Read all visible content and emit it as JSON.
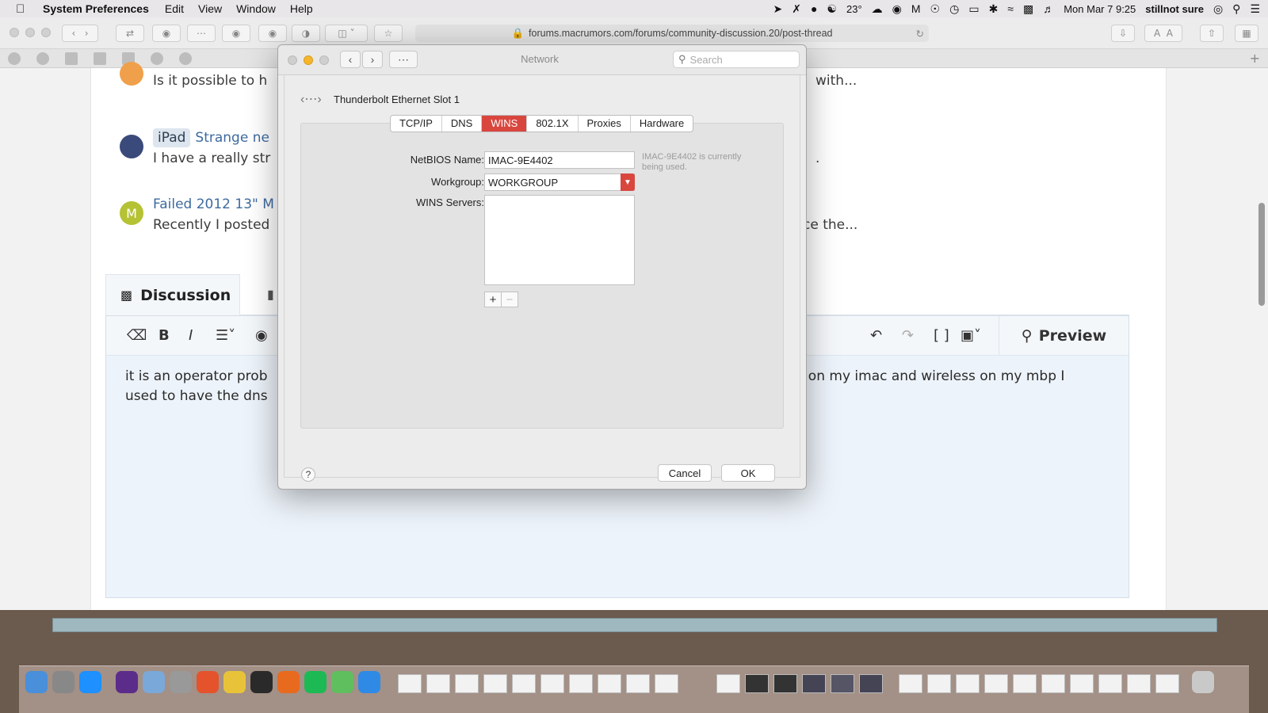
{
  "menubar": {
    "app_name": "System Preferences",
    "items": [
      "Edit",
      "View",
      "Window",
      "Help"
    ],
    "status": {
      "temperature": "23°",
      "datetime": "Mon Mar 7  9:25",
      "user": "stillnot sure"
    }
  },
  "browser": {
    "url": "forums.macrumors.com/forums/community-discussion.20/post-thread"
  },
  "forum": {
    "threads": [
      {
        "avatar_letter": "",
        "tag": "",
        "title": "",
        "snippet": "Is it possible to h",
        "snippet_end": "with..."
      },
      {
        "avatar_letter": "",
        "tag": "iPad",
        "title": "Strange ne",
        "snippet": "I have a really str",
        "snippet_end": "."
      },
      {
        "avatar_letter": "M",
        "tag": "",
        "title": "Failed 2012 13\" M",
        "snippet": "Recently I posted",
        "snippet_end": "ce the..."
      }
    ],
    "discussion_tab": "Discussion",
    "preview_label": "Preview",
    "editor_text_line1_start": "it is an operator prob",
    "editor_text_line1_end": "o on my imac and wireless on my mbp I",
    "editor_text_line2_start": "used to have the dns"
  },
  "dialog": {
    "title": "Network",
    "search_placeholder": "Search",
    "interface_name": "Thunderbolt Ethernet Slot 1",
    "tabs": [
      "TCP/IP",
      "DNS",
      "WINS",
      "802.1X",
      "Proxies",
      "Hardware"
    ],
    "active_tab": "WINS",
    "netbios_label": "NetBIOS Name:",
    "netbios_value": "IMAC-9E4402",
    "netbios_note": "IMAC-9E4402 is currently being used.",
    "workgroup_label": "Workgroup:",
    "workgroup_value": "WORKGROUP",
    "wins_servers_label": "WINS Servers:",
    "help": "?",
    "cancel_label": "Cancel",
    "ok_label": "OK"
  },
  "colors": {
    "accent": "#d9463e",
    "link": "#3e6aa0"
  }
}
